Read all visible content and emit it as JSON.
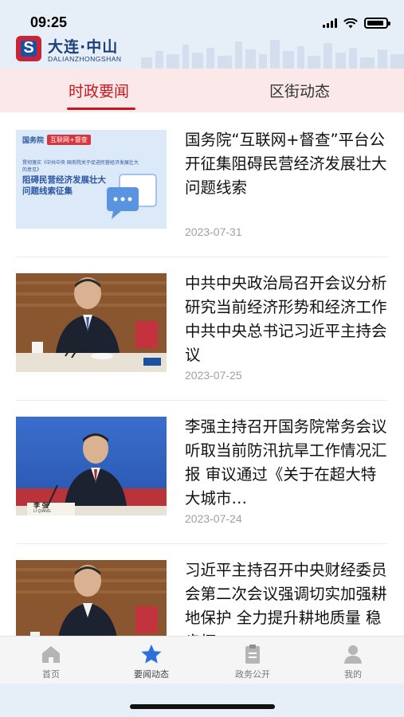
{
  "status_bar": {
    "time": "09:25"
  },
  "header": {
    "brand_title": "大连·中山",
    "brand_subtitle": "DALIANZHONGSHAN"
  },
  "tabs": [
    {
      "label": "时政要闻",
      "active": true
    },
    {
      "label": "区街动态",
      "active": false
    }
  ],
  "articles": [
    {
      "title": "国务院“互联网+督查”平台公开征集阻碍民营经济发展壮大问题线索",
      "date": "2023-07-31",
      "thumb_tag_1": "国务院",
      "thumb_tag_2": "互联网+督查",
      "thumb_sub": "贯彻落实《中共中央 国务院关于促进民营经济发展壮大的意见》",
      "thumb_main": "阻碍民营经济发展壮大问题线索征集"
    },
    {
      "title": "中共中央政治局召开会议分析研究当前经济形势和经济工作 中共中央总书记习近平主持会议",
      "date": "2023-07-25"
    },
    {
      "title": "李强主持召开国务院常务会议 听取当前防汛抗旱工作情况汇报 审议通过《关于在超大特大城市…",
      "date": "2023-07-24",
      "thumb_nameplate": "李 强",
      "thumb_nameplate_en": "LI QIANG"
    },
    {
      "title": "习近平主持召开中央财经委员会第二次会议强调切实加强耕地保护 全力提升耕地质量 稳步拓",
      "date": ""
    }
  ],
  "tabbar": [
    {
      "label": "首页",
      "icon": "home-icon",
      "active": false
    },
    {
      "label": "要闻动态",
      "icon": "star-icon",
      "active": true
    },
    {
      "label": "政务公开",
      "icon": "clipboard-icon",
      "active": false
    },
    {
      "label": "我的",
      "icon": "person-icon",
      "active": false
    }
  ],
  "colors": {
    "accent": "#c8161e",
    "active_icon": "#2f6fdb",
    "inactive_icon": "#b5b5b5"
  }
}
